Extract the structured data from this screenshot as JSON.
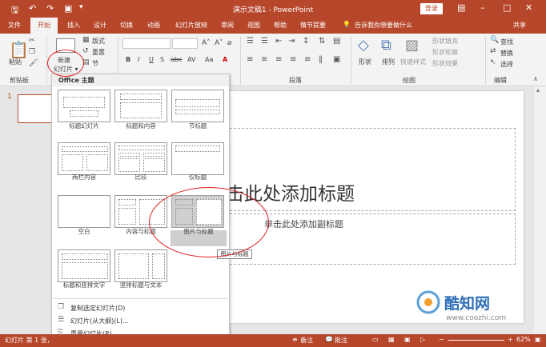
{
  "titlebar": {
    "title": "演示文稿1  -  PowerPoint",
    "login": "登录",
    "save_icon": "save-icon",
    "undo_icon": "undo-icon",
    "redo_icon": "redo-icon",
    "present_icon": "present-icon",
    "window_icons": [
      "ribbon-options-icon",
      "minimize-icon",
      "restore-icon",
      "close-icon"
    ]
  },
  "tabs": [
    "文件",
    "开始",
    "插入",
    "设计",
    "切换",
    "动画",
    "幻灯片放映",
    "审阅",
    "视图",
    "帮助",
    "情节提要"
  ],
  "active_tab": "开始",
  "tellme": "告诉我你想要做什么",
  "share": "共享",
  "ribbon": {
    "paste": "粘贴",
    "clipboard": "剪贴板",
    "new_slide_line1": "新建",
    "new_slide_line2": "幻灯片 ▾",
    "layout": "版式",
    "reset": "重置",
    "section": "节",
    "font_buttons": [
      "B",
      "I",
      "U",
      "S",
      "abc",
      "AV",
      "Aa",
      "A"
    ],
    "paragraph": "段落",
    "shapes": "形状",
    "arrange": "排列",
    "quick_styles": "快速样式",
    "shape_fill": "形状填充",
    "shape_outline": "形状轮廓",
    "shape_effects": "形状效果",
    "drawing": "绘图",
    "find": "查找",
    "replace": "替换",
    "select": "选择",
    "editing": "编辑"
  },
  "dropdown": {
    "header": "Office 主题",
    "layouts": [
      {
        "label": "标题幻灯片"
      },
      {
        "label": "标题和内容"
      },
      {
        "label": "节标题"
      },
      {
        "label": "两栏内容"
      },
      {
        "label": "比较"
      },
      {
        "label": "仅标题"
      },
      {
        "label": "空白"
      },
      {
        "label": "内容与标题"
      },
      {
        "label": "图片与标题",
        "selected": true
      },
      {
        "label": "标题和竖排文字"
      },
      {
        "label": "竖排标题与文本"
      }
    ],
    "menu_items": [
      "复制选定幻灯片(D)",
      "幻灯片(从大纲)(L)...",
      "重用幻灯片(R)..."
    ],
    "tooltip": "图片与标题"
  },
  "slide": {
    "number": "1",
    "title_placeholder": "单击此处添加标题",
    "title_visible": "击此处添加标题",
    "subtitle_placeholder": "单击此处添加副标题"
  },
  "statusbar": {
    "slide_info": "幻灯片 第 1 张，",
    "notes": "备注",
    "comments": "批注",
    "zoom": "62%"
  },
  "watermark": {
    "brand": "酷知网",
    "url": "www.coozhi.com"
  },
  "colors": {
    "accent": "#b7472a",
    "annotation": "#dd2222"
  }
}
